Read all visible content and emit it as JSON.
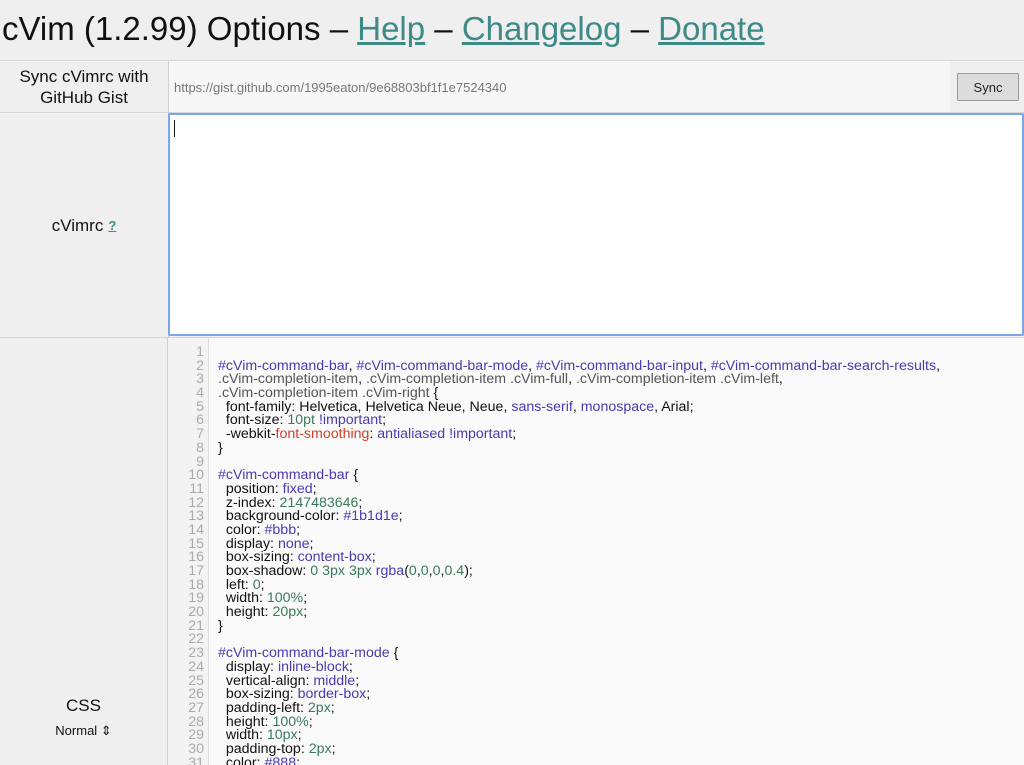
{
  "header": {
    "title": "cVim (1.2.99) Options",
    "sep": "–",
    "links": [
      "Help",
      "Changelog",
      "Donate"
    ]
  },
  "sync": {
    "label": "Sync cVimrc with GitHub Gist",
    "gist_url": "https://gist.github.com/1995eaton/9e68803bf1f1e7524340",
    "button": "Sync"
  },
  "cvimrc": {
    "label": "cVimrc",
    "help": "?"
  },
  "css": {
    "label": "CSS",
    "mode": "Normal ⇕",
    "lines": [
      {
        "n": "1",
        "t": ""
      },
      {
        "n": "2",
        "t": "#cVim-command-bar, #cVim-command-bar-mode, #cVim-command-bar-input, #cVim-command-bar-search-results,"
      },
      {
        "n": "3",
        "t": ".cVim-completion-item, .cVim-completion-item .cVim-full, .cVim-completion-item .cVim-left,"
      },
      {
        "n": "4",
        "t": ".cVim-completion-item .cVim-right {"
      },
      {
        "n": "5",
        "t": "  font-family: Helvetica, Helvetica Neue, Neue, sans-serif, monospace, Arial;"
      },
      {
        "n": "6",
        "t": "  font-size: 10pt !important;"
      },
      {
        "n": "7",
        "t": "  -webkit-font-smoothing: antialiased !important;"
      },
      {
        "n": "8",
        "t": "}"
      },
      {
        "n": "9",
        "t": ""
      },
      {
        "n": "10",
        "t": "#cVim-command-bar {"
      },
      {
        "n": "11",
        "t": "  position: fixed;"
      },
      {
        "n": "12",
        "t": "  z-index: 2147483646;"
      },
      {
        "n": "13",
        "t": "  background-color: #1b1d1e;"
      },
      {
        "n": "14",
        "t": "  color: #bbb;"
      },
      {
        "n": "15",
        "t": "  display: none;"
      },
      {
        "n": "16",
        "t": "  box-sizing: content-box;"
      },
      {
        "n": "17",
        "t": "  box-shadow: 0 3px 3px rgba(0,0,0,0.4);"
      },
      {
        "n": "18",
        "t": "  left: 0;"
      },
      {
        "n": "19",
        "t": "  width: 100%;"
      },
      {
        "n": "20",
        "t": "  height: 20px;"
      },
      {
        "n": "21",
        "t": "}"
      },
      {
        "n": "22",
        "t": ""
      },
      {
        "n": "23",
        "t": "#cVim-command-bar-mode {"
      },
      {
        "n": "24",
        "t": "  display: inline-block;"
      },
      {
        "n": "25",
        "t": "  vertical-align: middle;"
      },
      {
        "n": "26",
        "t": "  box-sizing: border-box;"
      },
      {
        "n": "27",
        "t": "  padding-left: 2px;"
      },
      {
        "n": "28",
        "t": "  height: 100%;"
      },
      {
        "n": "29",
        "t": "  width: 10px;"
      },
      {
        "n": "30",
        "t": "  padding-top: 2px;"
      },
      {
        "n": "31",
        "t": "  color: #888;"
      }
    ]
  },
  "colors": {
    "link": "#3d8a86",
    "keyword": "#4a3ab0",
    "number": "#3a7a5a",
    "warn": "#d0402a",
    "focus": "#7aa7e6"
  }
}
